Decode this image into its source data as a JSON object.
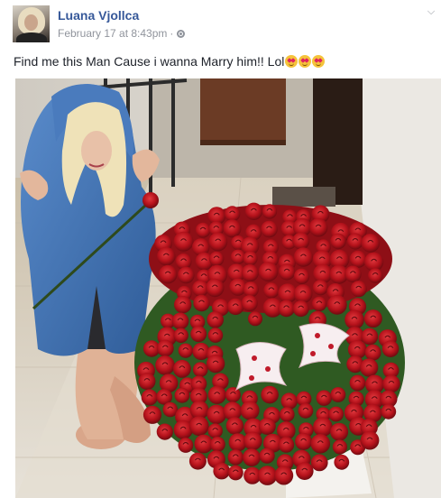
{
  "post": {
    "author": "Luana Vjollca",
    "timestamp": "February 17 at 8:43pm",
    "separator": "·",
    "privacy_icon": "globe-icon",
    "menu_icon": "chevron-down-icon",
    "message": "Find me this Man Cause i wanna Marry him!! Lol",
    "emoji_icon": "heart-eyes-emoji-icon",
    "emoji_count": 3
  },
  "colors": {
    "author_link": "#365899",
    "meta_text": "#90949c",
    "body_text": "#1d2129",
    "roses": "#c0161e",
    "hoodie": "#3f6fb0"
  }
}
